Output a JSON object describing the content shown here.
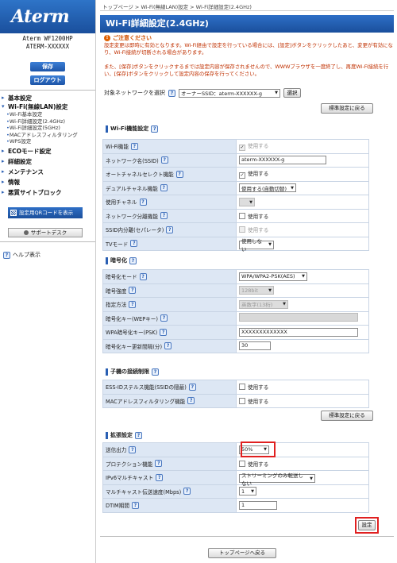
{
  "sidebar": {
    "logo": "Aterm",
    "model_line1": "Aterm WF1200HP",
    "model_line2": "ATERM-XXXXXX",
    "save_button": "保存",
    "logout_button": "ログアウト",
    "menu": {
      "basic": "基本設定",
      "wifi": "Wi-Fi(無線LAN)設定",
      "wifi_items": [
        "Wi-Fi基本設定",
        "Wi-Fi詳細設定(2.4GHz)",
        "Wi-Fi詳細設定(5GHz)",
        "MACアドレスフィルタリング",
        "WPS設定"
      ],
      "eco": "ECOモード設定",
      "detail": "詳細設定",
      "maint": "メンテナンス",
      "info": "情報",
      "block": "悪質サイトブロック"
    },
    "qr_button": "設定用QRコードを表示",
    "support_button": "サポートデスク",
    "help": "ヘルプ表示"
  },
  "breadcrumb": "トップページ > Wi-Fi(無線LAN)設定 > Wi-Fi詳細設定(2.4GHz)",
  "title": "Wi-Fi詳細設定(2.4GHz)",
  "caution": {
    "title": "ご注意ください",
    "line1": "設定変更は即時に有効となります。Wi-Fi経由で設定を行っている場合には、[設定]ボタンをクリックしたあと、変更が有効になり、Wi-Fi接続が切断される場合があります。",
    "line2": "また、[保存]ボタンをクリックするまでは設定内容が保存されませんので、WWWブラウザを一度終了し、再度Wi-Fi接続を行い、[保存]ボタンをクリックして設定内容の保存を行ってください。"
  },
  "network_select": {
    "label": "対象ネットワークを選択",
    "help": "?",
    "value": "オーナーSSID：aterm-XXXXXX-g",
    "button": "選択"
  },
  "reset_button": "標準設定に戻る",
  "sections": {
    "func": {
      "title": "Wi-Fi機能設定",
      "rows": [
        {
          "label": "Wi-Fi機能",
          "value": "使用する"
        },
        {
          "label": "ネットワーク名(SSID)",
          "value": "aterm-XXXXXX-g"
        },
        {
          "label": "オートチャネルセレクト機能",
          "value": "使用する"
        },
        {
          "label": "デュアルチャネル機能",
          "value": "使用する(自動切替)"
        },
        {
          "label": "使用チャネル",
          "value": ""
        },
        {
          "label": "ネットワーク分離機能",
          "value": "使用する"
        },
        {
          "label": "SSID内分離(セパレータ)",
          "value": "使用する"
        },
        {
          "label": "TVモード",
          "value": "使用しない"
        }
      ]
    },
    "enc": {
      "title": "暗号化",
      "rows": [
        {
          "label": "暗号化モード",
          "value": "WPA/WPA2-PSK(AES)"
        },
        {
          "label": "暗号強度",
          "value": "128bit"
        },
        {
          "label": "指定方法",
          "value": "英数字(13桁)"
        },
        {
          "label": "暗号化キー(WEPキー)",
          "value": ""
        },
        {
          "label": "WPA暗号化キー(PSK)",
          "value": "XXXXXXXXXXXXX"
        },
        {
          "label": "暗号化キー更新間隔(分)",
          "value": "30"
        }
      ]
    },
    "child": {
      "title": "子機の接続制限",
      "rows": [
        {
          "label": "ESS-IDステルス機能(SSIDの隠蔽)",
          "value": "使用する"
        },
        {
          "label": "MACアドレスフィルタリング機能",
          "value": "使用する"
        }
      ]
    },
    "ext": {
      "title": "拡張設定",
      "rows": [
        {
          "label": "送信出力",
          "value": "50%"
        },
        {
          "label": "プロテクション機能",
          "value": "使用する"
        },
        {
          "label": "IPv6マルチキャスト",
          "value": "ストリーミングのみ転送しない"
        },
        {
          "label": "マルチキャスト伝送速度(Mbps)",
          "value": "1"
        },
        {
          "label": "DTIM期間",
          "value": "1"
        }
      ]
    }
  },
  "set_button": "設定",
  "top_button": "トップページへ戻る",
  "colors": {
    "accent": "#1a4f9c",
    "label_bg": "#dde7f4",
    "highlight": "#e02020",
    "caution": "#c03000"
  }
}
